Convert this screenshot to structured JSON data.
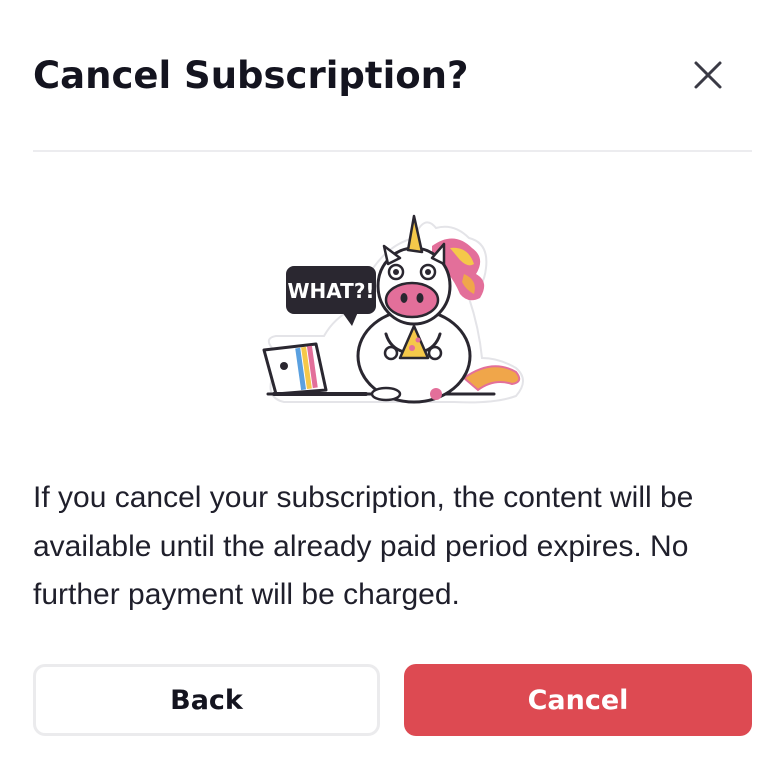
{
  "dialog": {
    "title": "Cancel Subscription?",
    "close_icon": "close-icon",
    "illustration": {
      "speech_bubble_text": "WHAT?!",
      "colors": {
        "pink": "#e36f9a",
        "orange": "#f0a64a",
        "yellow": "#f5c84a",
        "dark": "#2a2730"
      }
    },
    "message": "If you cancel your subscription, the content will be available until the already paid period expires. No further payment will be charged.",
    "buttons": {
      "back_label": "Back",
      "cancel_label": "Cancel"
    },
    "colors": {
      "cancel_button": "#dd4a52",
      "back_border": "#ebebed",
      "divider": "#ececef",
      "title": "#14141f"
    }
  }
}
